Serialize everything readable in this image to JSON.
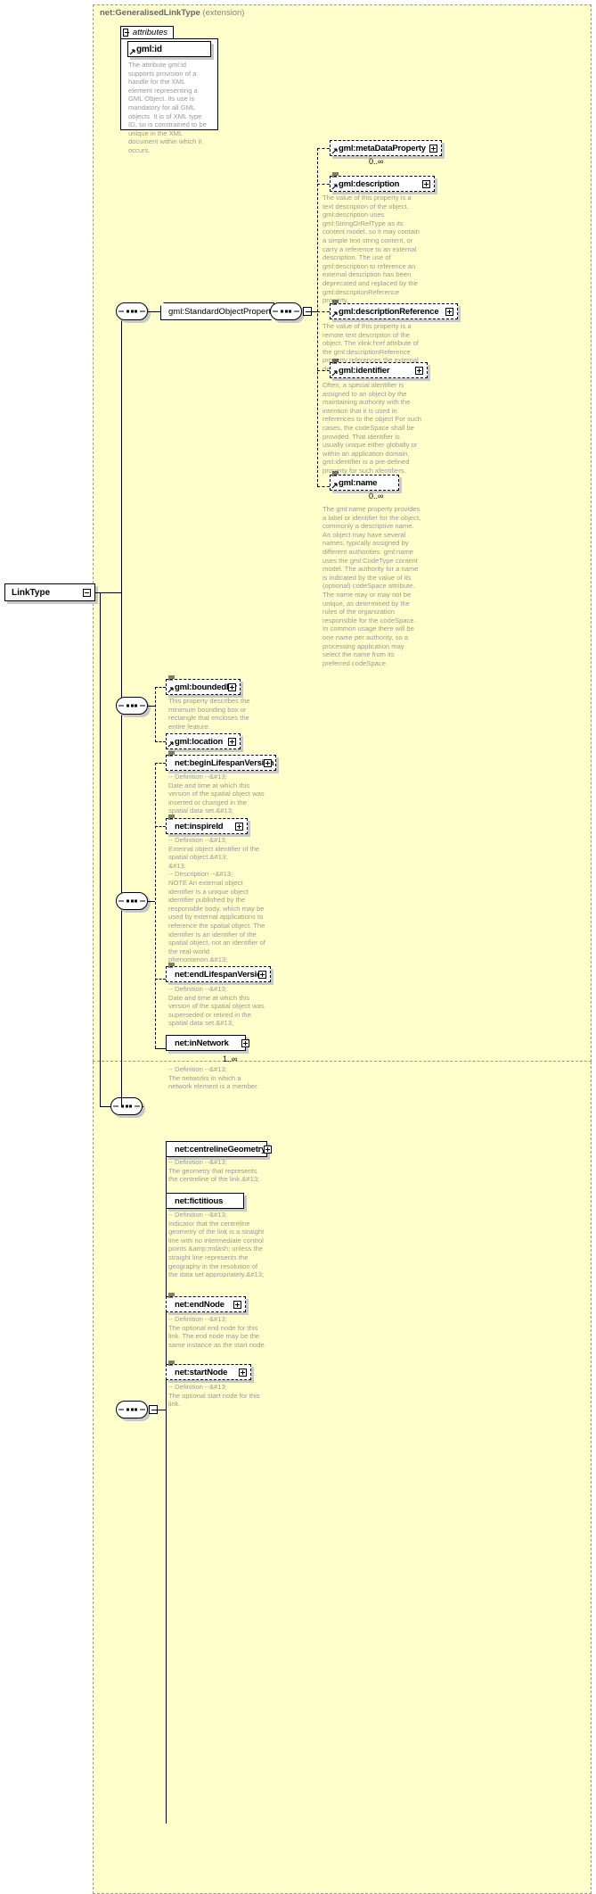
{
  "diagram": {
    "type": "xsd-schema-diagram",
    "root_element": "LinkType",
    "extension_title_name": "net:GeneralisedLinkType",
    "extension_title_suffix": "(extension)",
    "attributes_label": "attributes",
    "group_ref_label": "gml:StandardObjectProperties"
  },
  "attributes": {
    "items": [
      {
        "name": "gml:id",
        "annotation": "The attribute gml:id supports provision of a handle for the XML element representing a GML Object. Its use is mandatory for all GML objects. It is of XML type ID, so is constrained to be unique in the XML document within which it occurs."
      }
    ]
  },
  "standard_object_properties": {
    "elements": [
      {
        "name": "gml:metaDataProperty",
        "cardinality": "0..∞",
        "annotation": "",
        "style": "dashed",
        "expander": "plus"
      },
      {
        "name": "gml:description",
        "cardinality": "",
        "annotation": "The value of this property is a text description of the object. gml:description uses gml:StringOrRefType as its content model, so it may contain a simple text string content, or carry a reference to an external description. The use of gml:description to reference an external description has been deprecated and replaced by the gml:descriptionReference property.",
        "style": "dashed",
        "expander": "plus"
      },
      {
        "name": "gml:descriptionReference",
        "cardinality": "",
        "annotation": "The value of this property is a remote text description of the object. The xlink:href attribute of the gml:descriptionReference property references the external description.",
        "style": "dashed",
        "expander": "plus"
      },
      {
        "name": "gml:identifier",
        "cardinality": "",
        "annotation": "Often, a special identifier is assigned to an object by the maintaining authority with the intention that it is used in references to the object For such cases, the codeSpace shall be provided. That identifier is usually unique either globally or within an application domain. gml:identifier is a pre-defined property for such identifiers.",
        "style": "dashed",
        "expander": "plus"
      },
      {
        "name": "gml:name",
        "cardinality": "0..∞",
        "annotation": "The gml:name property provides a label or identifier for the object, commonly a descriptive name. An object may have several names, typically assigned by different authorities. gml:name uses the gml:CodeType content model. The authority for a name is indicated by the value of its (optional) codeSpace attribute. The name may or may not be unique, as determined by the rules of the organization responsible for the codeSpace. In common usage there will be one name per authority, so a processing application may select the name from its preferred codeSpace.",
        "style": "dashed",
        "expander": "plus"
      }
    ]
  },
  "abstract_feature_properties": {
    "elements": [
      {
        "name": "gml:boundedBy",
        "cardinality": "",
        "annotation": "This property describes the minimum bounding box or rectangle that encloses the entire feature.",
        "style": "dashed",
        "expander": "plus"
      },
      {
        "name": "gml:location",
        "cardinality": "",
        "annotation": "",
        "style": "dashed",
        "expander": "plus"
      }
    ]
  },
  "network_element_properties": {
    "elements": [
      {
        "name": "net:beginLifespanVersion",
        "cardinality": "",
        "annotation": "-- Definition --&#13;\nDate and time at which this version of the spatial object was inserted or changed in the spatial data set.&#13;",
        "style": "dashed",
        "expander": "plus"
      },
      {
        "name": "net:inspireId",
        "cardinality": "",
        "annotation": "-- Definition --&#13;\nExternal object identifier of the spatial object.&#13;\n&#13;\n-- Description --&#13;\nNOTE An external object identifier is a unique object identifier published by the responsible body, which may be used by external applications to reference the spatial object. The identifier is an identifier of the spatial object, not an identifier of the real-world phenomenon.&#13;",
        "style": "dashed",
        "expander": "plus"
      },
      {
        "name": "net:endLifespanVersion",
        "cardinality": "",
        "annotation": "-- Definition --&#13;\nDate and time at which this version of the spatial object was superseded or retired in the spatial data set.&#13;",
        "style": "dashed",
        "expander": "plus"
      },
      {
        "name": "net:inNetwork",
        "cardinality": "1..∞",
        "annotation": "-- Definition --&#13;\nThe networks in which a network element is a member.",
        "style": "solid",
        "expander": "plus"
      }
    ]
  },
  "link_properties": {
    "elements": [
      {
        "name": "net:centrelineGeometry",
        "cardinality": "",
        "annotation": "-- Definition --&#13;\nThe geometry that represents the centreline of the link.&#13;",
        "style": "solid",
        "expander": "plus"
      },
      {
        "name": "net:fictitious",
        "cardinality": "",
        "annotation": "-- Definition --&#13;\nIndicator that the centreline geometry of the link is a straight line with no intermediate control points &amp;mdash; unless the straight line represents the geography in the resolution of the data set appropriately.&#13;",
        "style": "solid",
        "expander": "none"
      },
      {
        "name": "net:endNode",
        "cardinality": "",
        "annotation": "-- Definition --&#13;\nThe optional end node for this link. The end node may be the same instance as the start node.",
        "style": "dashed",
        "expander": "plus"
      },
      {
        "name": "net:startNode",
        "cardinality": "",
        "annotation": "-- Definition --&#13;\nThe optional start node for this link.",
        "style": "dashed",
        "expander": "plus"
      }
    ]
  },
  "colors": {
    "panel_fill": "#ffffcc",
    "panel_border": "#999999",
    "annotation_text": "#999999",
    "line": "#000000",
    "box_fill": "#ffffff",
    "shadow": "#c8c8c8"
  }
}
